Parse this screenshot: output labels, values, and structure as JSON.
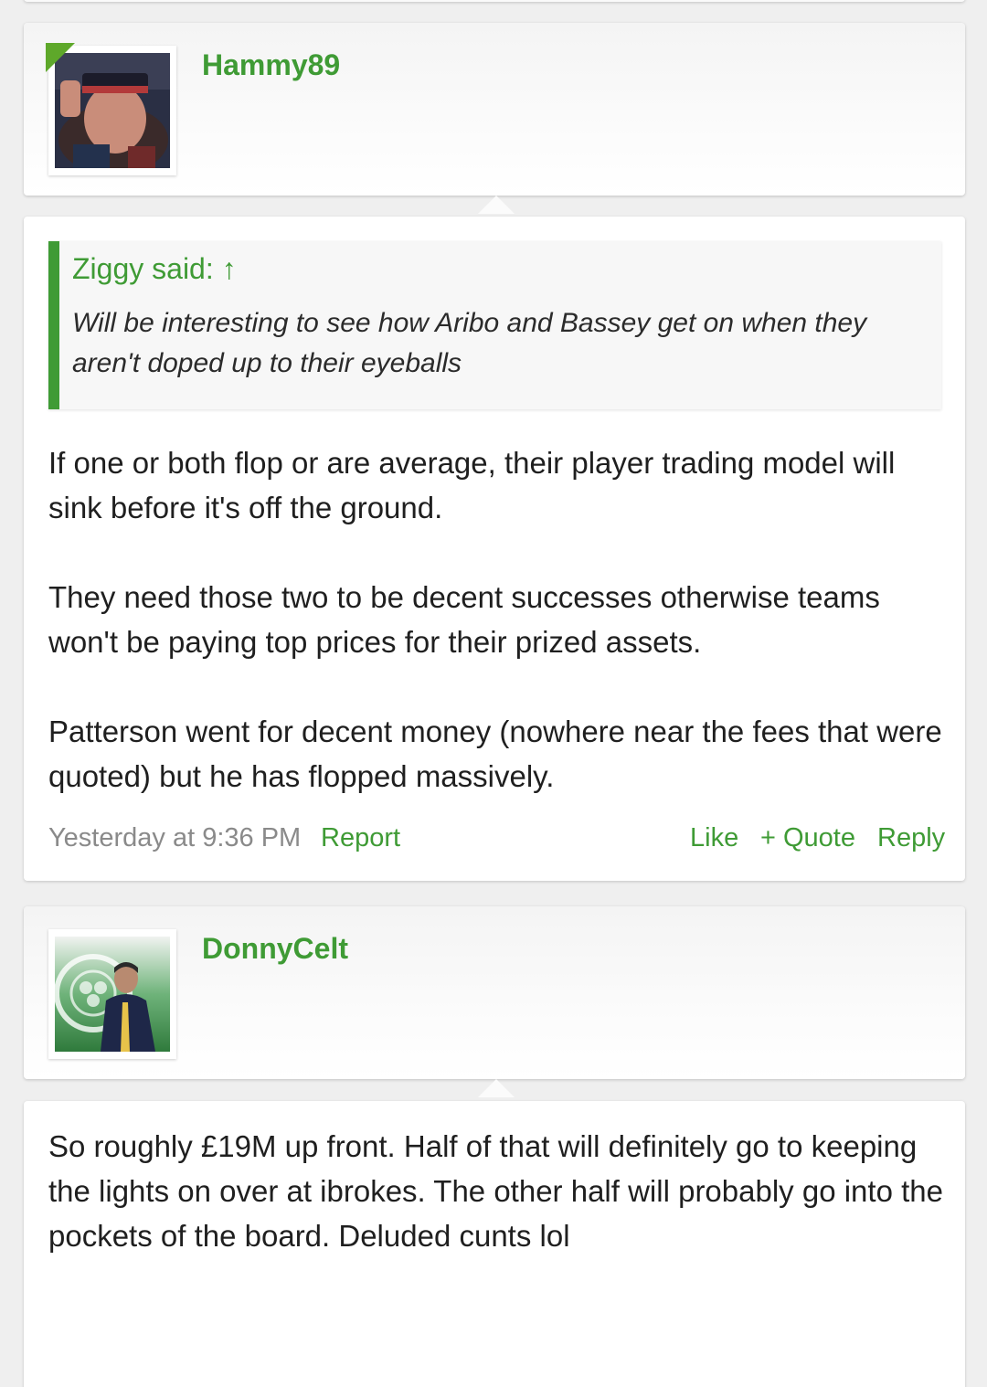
{
  "posts": [
    {
      "author": "Hammy89",
      "quote": {
        "author_label": "Ziggy said: ↑",
        "text": "Will be interesting to see how Aribo and Bassey get on when they aren't doped up to their eyeballs"
      },
      "paragraphs": [
        "If one or both flop or are average, their player trading model will sink before it's off the ground.",
        "They need those two to be decent successes otherwise teams won't be paying top prices for their prized assets.",
        "Patterson went for decent money (nowhere near the fees that were quoted) but he has flopped massively."
      ],
      "timestamp": "Yesterday at 9:36 PM",
      "actions": {
        "report": "Report",
        "like": "Like",
        "quote": "+ Quote",
        "reply": "Reply"
      }
    },
    {
      "author": "DonnyCelt",
      "paragraphs": [
        "So roughly £19M up front. Half of that will definitely go to keeping the lights on over at ibrokes. The other half will probably go into the pockets of the board. Deluded cunts lol"
      ]
    }
  ],
  "colors": {
    "accent": "#3f9b35",
    "online": "#5ea82a",
    "muted": "#8a8a8a"
  }
}
